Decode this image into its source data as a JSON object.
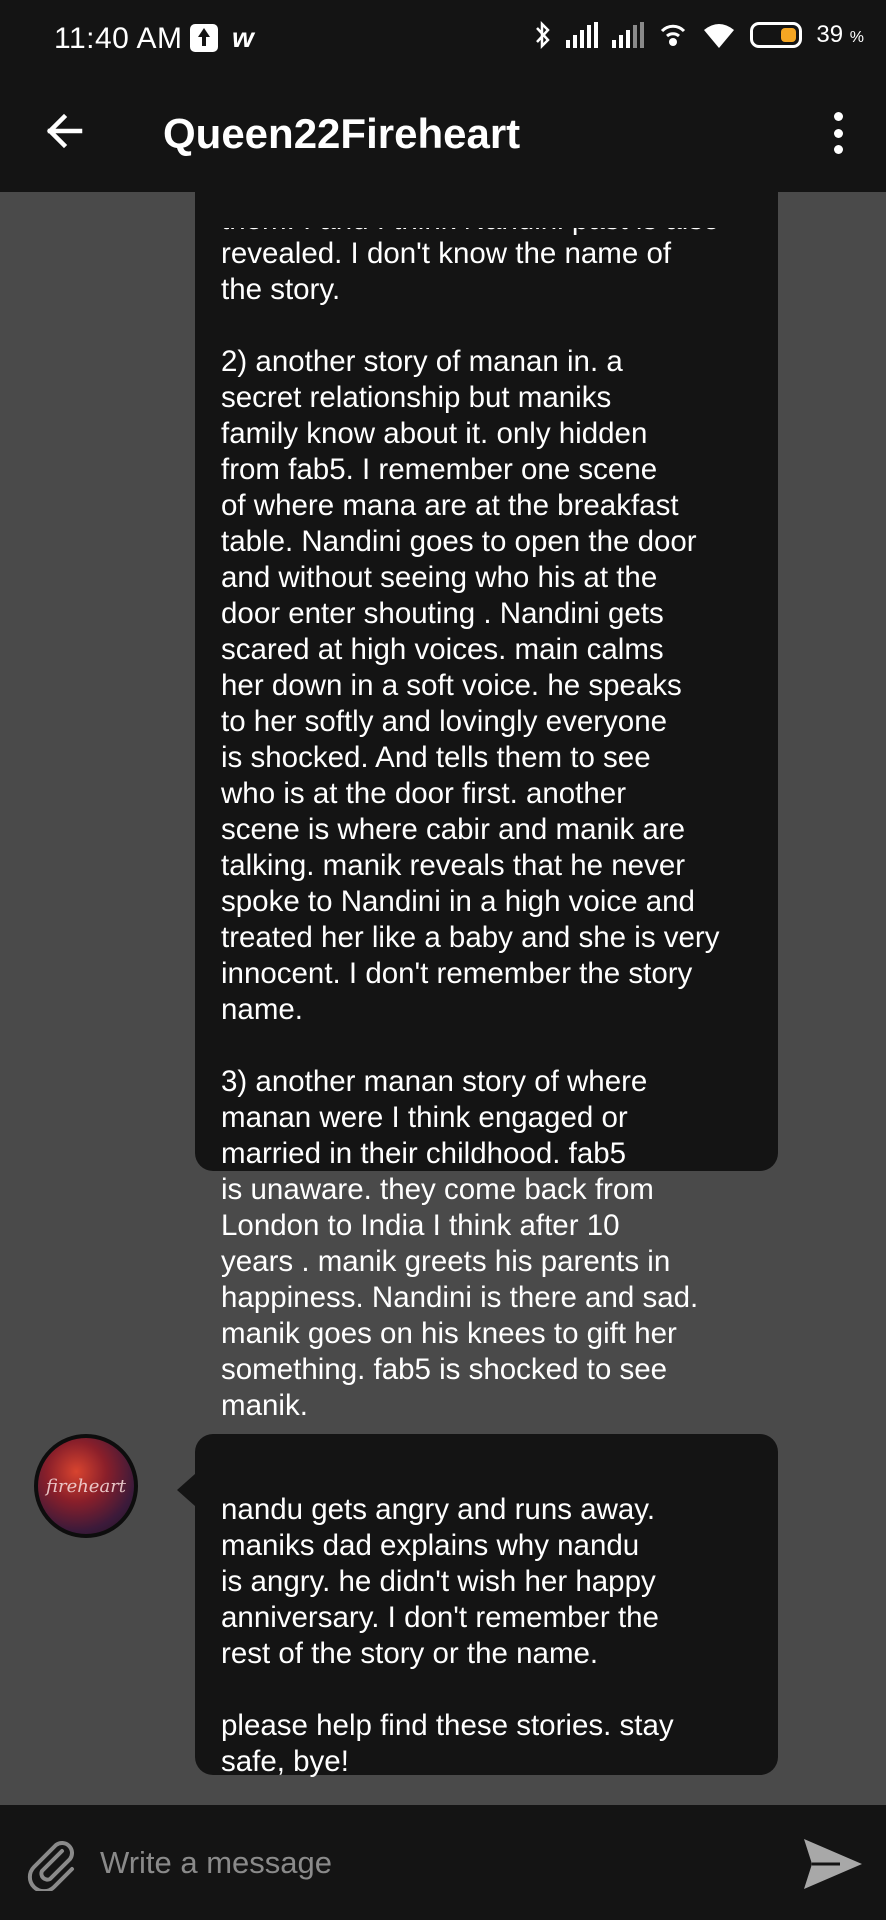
{
  "status_bar": {
    "time": "11:40 AM",
    "battery_percent": "39",
    "battery_unit": "%",
    "battery_level": 0.39,
    "battery_color": "#f5a623",
    "icons": [
      "upload-icon",
      "w-app-icon",
      "bluetooth-icon",
      "signal-icon",
      "signal-icon",
      "hotspot-icon",
      "wifi-icon",
      "battery-icon"
    ]
  },
  "app_bar": {
    "title": "Queen22Fireheart",
    "back_icon": "arrow-left-icon",
    "menu_icon": "more-vertical-icon"
  },
  "messages": [
    {
      "clipped_top_line": "them. I and I think Nandini past is also",
      "text": "revealed. I don't know the name of\nthe story.\n\n2) another story of manan in. a\nsecret relationship but maniks\nfamily know about it. only hidden\nfrom fab5. I remember one scene\nof where mana are at the breakfast\ntable. Nandini goes to open the door\nand without seeing who his at the\ndoor enter shouting . Nandini gets\nscared at high voices. main calms\nher down in a soft voice. he speaks\nto her softly and lovingly everyone\nis shocked. And tells them to see\nwho is at the door first. another\nscene is where cabir and manik are\ntalking. manik reveals that he never\nspoke to Nandini in a high voice and\ntreated her like a baby and she is very\ninnocent. I don't remember the story\nname.\n\n3) another manan story of where\nmanan were I think engaged or\nmarried in their childhood. fab5\nis unaware. they come back from\nLondon to India  I think after 10\nyears . manik greets his parents in\nhappiness. Nandini is there and sad.\nmanik goes on his knees to gift her\nsomething. fab5 is shocked to see\nmanik."
    },
    {
      "avatar_text": "fireheart",
      "text": "nandu gets angry and runs away.\nmaniks dad explains why nandu\nis angry. he didn't wish her happy\nanniversary. I don't remember the\nrest of the story or the name.\n\nplease help find these stories. stay\nsafe, bye!"
    }
  ],
  "composer": {
    "placeholder": "Write a message",
    "attach_icon": "paperclip-icon",
    "send_icon": "send-icon"
  }
}
